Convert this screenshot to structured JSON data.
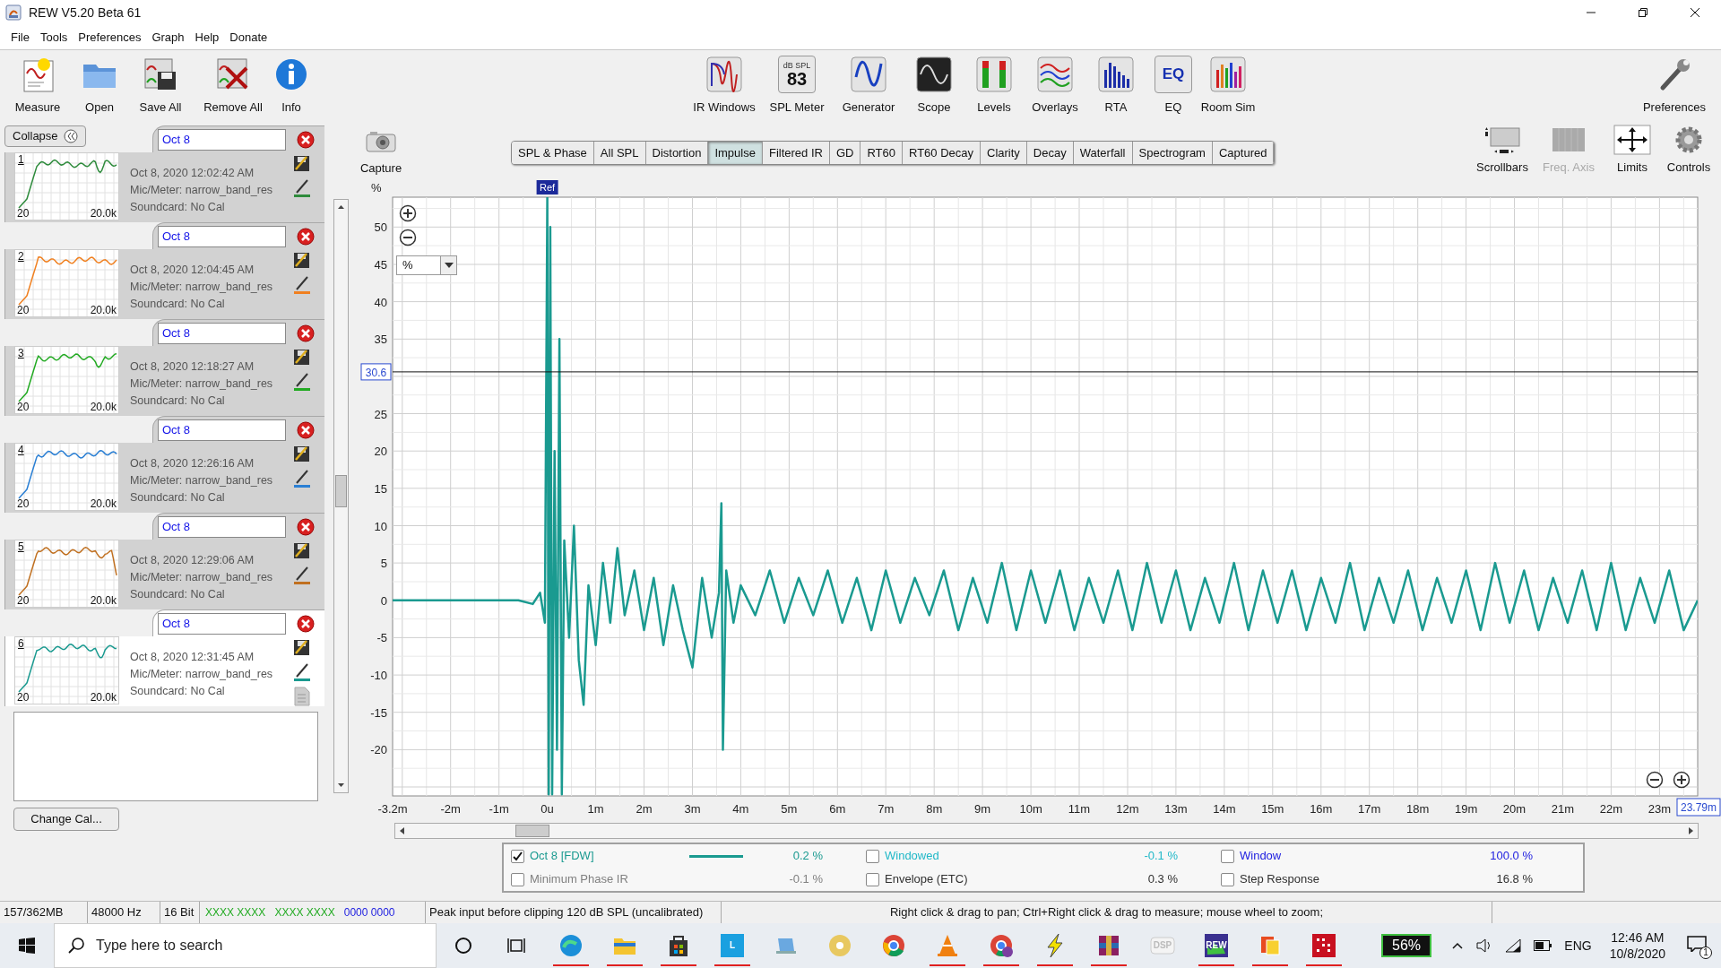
{
  "window": {
    "title": "REW V5.20 Beta 61"
  },
  "menu": [
    "File",
    "Tools",
    "Preferences",
    "Graph",
    "Help",
    "Donate"
  ],
  "toolbar": {
    "left": [
      "Measure",
      "Open",
      "Save All",
      "Remove All",
      "Info"
    ],
    "right": [
      "IR Windows",
      "SPL Meter",
      "Generator",
      "Scope",
      "Levels",
      "Overlays",
      "RTA",
      "EQ",
      "Room Sim"
    ],
    "end": "Preferences",
    "spl_unit": "dB SPL",
    "spl_reading": "83",
    "eq_logo": "EQ"
  },
  "measurements": {
    "collapse": "Collapse",
    "change_cal": "Change Cal...",
    "items": [
      {
        "name": "Oct 8",
        "number": "1",
        "x_min": "20",
        "x_max": "20.0k",
        "date": "Oct 8, 2020 12:02:42 AM",
        "mic": "Mic/Meter: narrow_band_res",
        "soundcard": "Soundcard: No Cal",
        "color": "#2e8b3c",
        "selected": false
      },
      {
        "name": "Oct 8",
        "number": "2",
        "x_min": "20",
        "x_max": "20.0k",
        "date": "Oct 8, 2020 12:04:45 AM",
        "mic": "Mic/Meter: narrow_band_res",
        "soundcard": "Soundcard: No Cal",
        "color": "#f08020",
        "selected": false
      },
      {
        "name": "Oct 8",
        "number": "3",
        "x_min": "20",
        "x_max": "20.0k",
        "date": "Oct 8, 2020 12:18:27 AM",
        "mic": "Mic/Meter: narrow_band_res",
        "soundcard": "Soundcard: No Cal",
        "color": "#22aa22",
        "selected": false
      },
      {
        "name": "Oct 8",
        "number": "4",
        "x_min": "20",
        "x_max": "20.0k",
        "date": "Oct 8, 2020 12:26:16 AM",
        "mic": "Mic/Meter: narrow_band_res",
        "soundcard": "Soundcard: No Cal",
        "color": "#2a7fd4",
        "selected": false
      },
      {
        "name": "Oct 8",
        "number": "5",
        "x_min": "20",
        "x_max": "20.0k",
        "date": "Oct 8, 2020 12:29:06 AM",
        "mic": "Mic/Meter: narrow_band_res",
        "soundcard": "Soundcard: No Cal",
        "color": "#c07020",
        "selected": false
      },
      {
        "name": "Oct 8",
        "number": "6",
        "x_min": "20",
        "x_max": "20.0k",
        "date": "Oct 8, 2020 12:31:45 AM",
        "mic": "Mic/Meter: narrow_band_res",
        "soundcard": "Soundcard: No Cal",
        "color": "#1a9a90",
        "selected": true
      }
    ]
  },
  "graph": {
    "capture": "Capture",
    "tabs": [
      {
        "label": "SPL & Phase",
        "selected": false
      },
      {
        "label": "All SPL",
        "selected": false
      },
      {
        "label": "Distortion",
        "selected": false
      },
      {
        "label": "Impulse",
        "selected": true
      },
      {
        "label": "Filtered IR",
        "selected": false
      },
      {
        "label": "GD",
        "selected": false
      },
      {
        "label": "RT60",
        "selected": false
      },
      {
        "label": "RT60 Decay",
        "selected": false
      },
      {
        "label": "Clarity",
        "selected": false
      },
      {
        "label": "Decay",
        "selected": false
      },
      {
        "label": "Waterfall",
        "selected": false
      },
      {
        "label": "Spectrogram",
        "selected": false
      },
      {
        "label": "Captured",
        "selected": false
      }
    ],
    "view_buttons": [
      {
        "label": "Scrollbars",
        "disabled": false
      },
      {
        "label": "Freq. Axis",
        "disabled": true
      },
      {
        "label": "Limits",
        "disabled": false
      },
      {
        "label": "Controls",
        "disabled": false
      }
    ],
    "unit_select": "%",
    "chart_data": {
      "type": "line",
      "ylabel": "%",
      "grid": true,
      "ref_lines": [
        {
          "axis": "y",
          "value": 30.6,
          "label": "30.6"
        }
      ],
      "xlim": [
        -3.2,
        23.79
      ],
      "ylim": [
        -26.2,
        54
      ],
      "yticks": [
        50,
        45,
        40,
        35,
        25,
        20,
        15,
        10,
        5,
        0,
        -5,
        -10,
        -15,
        -20
      ],
      "xticks": [
        {
          "value": -3.2,
          "label": "-3.2m"
        },
        {
          "value": -2,
          "label": "-2m"
        },
        {
          "value": -1,
          "label": "-1m"
        },
        {
          "value": 0,
          "label": "0u"
        },
        {
          "value": 1,
          "label": "1m"
        },
        {
          "value": 2,
          "label": "2m"
        },
        {
          "value": 3,
          "label": "3m"
        },
        {
          "value": 4,
          "label": "4m"
        },
        {
          "value": 5,
          "label": "5m"
        },
        {
          "value": 6,
          "label": "6m"
        },
        {
          "value": 7,
          "label": "7m"
        },
        {
          "value": 8,
          "label": "8m"
        },
        {
          "value": 9,
          "label": "9m"
        },
        {
          "value": 10,
          "label": "10m"
        },
        {
          "value": 11,
          "label": "11m"
        },
        {
          "value": 12,
          "label": "12m"
        },
        {
          "value": 13,
          "label": "13m"
        },
        {
          "value": 14,
          "label": "14m"
        },
        {
          "value": 15,
          "label": "15m"
        },
        {
          "value": 16,
          "label": "16m"
        },
        {
          "value": 17,
          "label": "17m"
        },
        {
          "value": 18,
          "label": "18m"
        },
        {
          "value": 19,
          "label": "19m"
        },
        {
          "value": 20,
          "label": "20m"
        },
        {
          "value": 21,
          "label": "21m"
        },
        {
          "value": 22,
          "label": "22m"
        },
        {
          "value": 23,
          "label": "23m"
        }
      ],
      "x": [
        -3.2,
        -2,
        -1,
        -0.6,
        -0.3,
        -0.15,
        -0.05,
        0,
        0.03,
        0.06,
        0.1,
        0.15,
        0.2,
        0.25,
        0.3,
        0.35,
        0.45,
        0.55,
        0.65,
        0.75,
        0.85,
        1,
        1.15,
        1.3,
        1.45,
        1.6,
        1.8,
        2,
        2.2,
        2.4,
        2.6,
        2.8,
        3,
        3.2,
        3.4,
        3.55,
        3.6,
        3.63,
        3.7,
        3.85,
        4,
        4.3,
        4.6,
        4.9,
        5.2,
        5.5,
        5.8,
        6.1,
        6.4,
        6.7,
        7,
        7.3,
        7.6,
        7.9,
        8.2,
        8.5,
        8.8,
        9.1,
        9.4,
        9.7,
        10,
        10.3,
        10.6,
        10.9,
        11.2,
        11.5,
        11.8,
        12.1,
        12.4,
        12.7,
        13,
        13.3,
        13.6,
        13.9,
        14.2,
        14.5,
        14.8,
        15.1,
        15.4,
        15.7,
        16,
        16.3,
        16.6,
        16.9,
        17.2,
        17.5,
        17.8,
        18.1,
        18.4,
        18.7,
        19,
        19.3,
        19.6,
        19.9,
        20.2,
        20.5,
        20.8,
        21.1,
        21.4,
        21.7,
        22,
        22.3,
        22.6,
        22.9,
        23.2,
        23.5,
        23.79
      ],
      "series": [
        {
          "color": "#1a9a90",
          "values": [
            0,
            0,
            0,
            0,
            -0.5,
            1,
            -3,
            54,
            -26,
            50,
            -26,
            20,
            -20,
            35,
            -26,
            8,
            -5,
            10,
            -8,
            -14,
            2,
            -6,
            5,
            -3,
            7,
            -2,
            4,
            -4,
            3,
            -6,
            2,
            -4,
            -9,
            3,
            -5,
            1,
            13,
            -20,
            4,
            -3,
            2,
            -2,
            4,
            -3,
            3,
            -2,
            4,
            -3,
            3,
            -4,
            4,
            -3,
            3,
            -2,
            4,
            -4,
            3,
            -3,
            5,
            -4,
            4,
            -3,
            4,
            -4,
            3,
            -3,
            4,
            -4,
            5,
            -3,
            4,
            -4,
            3,
            -3,
            5,
            -4,
            4,
            -3,
            4,
            -4,
            3,
            -3,
            5,
            -4,
            3,
            -3,
            4,
            -4,
            3,
            -3,
            4,
            -4,
            5,
            -3,
            4,
            -4,
            3,
            -3,
            4,
            -4,
            5,
            -4,
            3,
            -3,
            4,
            -4,
            0
          ]
        }
      ]
    },
    "ref_marker": "Ref",
    "x_readout": "23.79m",
    "legend": [
      {
        "label": "Oct 8 [FDW]",
        "value": "0.2 %",
        "checked": true,
        "color": "#1a9a90",
        "show_line": true
      },
      {
        "label": "Windowed",
        "value": "-0.1 %",
        "checked": false,
        "color": "#20b8c8"
      },
      {
        "label": "Window",
        "value": "100.0 %",
        "checked": false,
        "color": "#2020e0"
      },
      {
        "label": "Minimum Phase IR",
        "value": "-0.1 %",
        "checked": false,
        "color": "#808080"
      },
      {
        "label": "Envelope (ETC)",
        "value": "0.3 %",
        "checked": false,
        "color": "#303030"
      },
      {
        "label": "Step Response",
        "value": "16.8 %",
        "checked": false,
        "color": "#303030"
      }
    ]
  },
  "status_bar": {
    "memory": "157/362MB",
    "rate": "48000 Hz",
    "bits": "16 Bit",
    "indicators": [
      {
        "text": "XXXX XXXX",
        "color": "#22aa22"
      },
      {
        "text": "XXXX XXXX",
        "color": "#22aa22"
      },
      {
        "text": "0000 0000",
        "color": "#2020e0"
      }
    ],
    "peak": "Peak input before clipping 120 dB SPL (uncalibrated)",
    "hint": "Right click & drag to pan; Ctrl+Right click & drag to measure; mouse wheel to zoom;"
  },
  "taskbar": {
    "search_placeholder": "Type here to search",
    "apps": [
      {
        "running": true
      },
      {
        "running": true
      },
      {
        "running": true
      },
      {
        "running": true,
        "label": "L"
      },
      {
        "running": false
      },
      {
        "running": false
      },
      {
        "running": false
      },
      {
        "running": true
      },
      {
        "running": true
      },
      {
        "running": true
      },
      {
        "running": true
      },
      {
        "running": false,
        "label": "DSP"
      },
      {
        "running": true,
        "label": "REW"
      },
      {
        "running": true
      },
      {
        "running": true
      }
    ],
    "battery": "56%",
    "language": "ENG",
    "time": "12:46 AM",
    "date": "10/8/2020",
    "notifications": "1"
  }
}
